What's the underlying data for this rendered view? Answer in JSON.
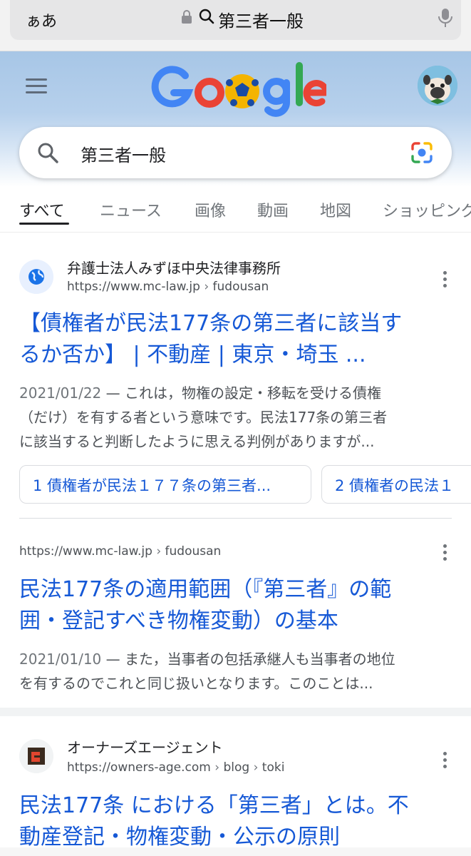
{
  "browser": {
    "aa_label": "ぁあ",
    "address_text": "第三者一般"
  },
  "search": {
    "query": "第三者一般"
  },
  "tabs": [
    {
      "label": "すべて",
      "active": true
    },
    {
      "label": "ニュース"
    },
    {
      "label": "画像"
    },
    {
      "label": "動画"
    },
    {
      "label": "地図"
    },
    {
      "label": "ショッピング"
    }
  ],
  "results": [
    {
      "site_name": "弁護士法人みずほ中央法律事務所",
      "url": "https://www.mc-law.jp",
      "path": "fudousan",
      "title_line1": "【債権者が民法177条の第三者に該当す",
      "title_line2": "るか否か】 | 不動産 | 東京・埼玉 ...",
      "date": "2021/01/22",
      "snippet_line1": " — これは，物権の設定・移転を受ける債権",
      "snippet_line2": "（だけ）を有する者という意味です。民法177条の第三者",
      "snippet_line3": "に該当すると判断したように思える判例がありますが...",
      "chips": [
        "1 債権者が民法１７７条の第三者...",
        "2 債権者の民法１"
      ]
    },
    {
      "url": "https://www.mc-law.jp",
      "path": "fudousan",
      "title_line1": "民法177条の適用範囲（『第三者』の範",
      "title_line2": "囲・登記すべき物権変動）の基本",
      "date": "2021/01/10",
      "snippet_line1": " — また，当事者の包括承継人も当事者の地位",
      "snippet_line2": "を有するのでこれと同じ扱いとなります。このことは..."
    },
    {
      "site_name": "オーナーズエージェント",
      "url": "https://owners-age.com",
      "path1": "blog",
      "path2": "toki",
      "title_line1": "民法177条 における「第三者」とは。不",
      "title_line2": "動産登記・物権変動・公示の原則"
    }
  ],
  "colors": {
    "link": "#1558d6",
    "header_top": "#a7c6e6"
  }
}
